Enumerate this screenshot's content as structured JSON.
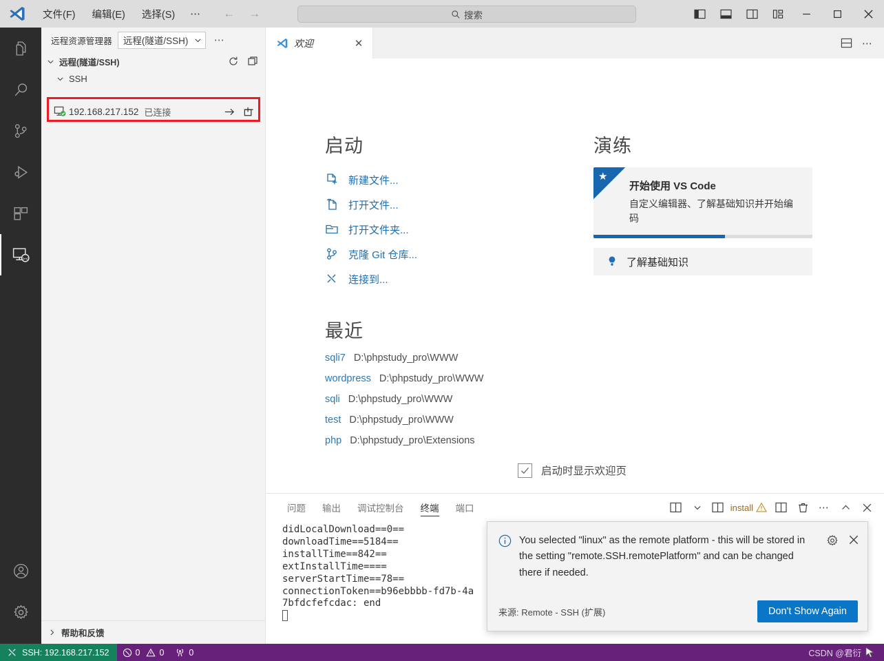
{
  "titlebar": {
    "menus": [
      "文件(F)",
      "编辑(E)",
      "选择(S)"
    ],
    "overflow": "⋯",
    "nav_back": "←",
    "nav_forward": "→",
    "search_placeholder": "搜索",
    "search_icon": "search-icon",
    "layout_buttons": [
      {
        "name": "toggle-primary-sidebar",
        "title": "切换主侧栏"
      },
      {
        "name": "toggle-panel",
        "title": "切换面板"
      },
      {
        "name": "toggle-secondary-sidebar",
        "title": "切换辅助侧栏"
      },
      {
        "name": "customize-layout",
        "title": "自定义布局"
      }
    ],
    "window_buttons": [
      "minimize",
      "maximize",
      "close"
    ]
  },
  "activitybar": {
    "items": [
      {
        "name": "explorer",
        "label": "资源管理器",
        "active": false
      },
      {
        "name": "search",
        "label": "搜索",
        "active": false
      },
      {
        "name": "source-control",
        "label": "源代码管理",
        "active": false
      },
      {
        "name": "run-debug",
        "label": "运行和调试",
        "active": false
      },
      {
        "name": "extensions",
        "label": "扩展",
        "active": false
      },
      {
        "name": "remote-explorer",
        "label": "远程资源管理器",
        "active": true
      }
    ],
    "bottom": [
      {
        "name": "accounts",
        "label": "帐户"
      },
      {
        "name": "manage",
        "label": "管理"
      }
    ]
  },
  "sidebar": {
    "title": "远程资源管理器",
    "selected_provider": "远程(隧道/SSH)",
    "more_actions": "⋯",
    "section": {
      "label": "远程(隧道/SSH)",
      "refresh_icon": "refresh-icon",
      "new_window_icon": "new-window-icon"
    },
    "group": {
      "label": "SSH"
    },
    "host": {
      "name": "192.168.217.152",
      "state": "已连接",
      "connect_icon": "arrow-right-icon",
      "new_window_icon": "open-new-window-icon"
    },
    "footer": {
      "label": "帮助和反馈"
    }
  },
  "editor": {
    "tab": {
      "label": "欢迎",
      "close": "✕",
      "icon": "vscode-logo-icon"
    },
    "tab_actions": {
      "split_icon": "split-editor-icon",
      "more_icon": "⋯"
    },
    "welcome": {
      "start_heading": "启动",
      "start_items": [
        {
          "label": "新建文件...",
          "icon": "new-file-icon"
        },
        {
          "label": "打开文件...",
          "icon": "open-file-icon"
        },
        {
          "label": "打开文件夹...",
          "icon": "open-folder-icon"
        },
        {
          "label": "克隆 Git 仓库...",
          "icon": "git-clone-icon"
        },
        {
          "label": "连接到...",
          "icon": "remote-connect-icon"
        }
      ],
      "recent_heading": "最近",
      "recent_items": [
        {
          "name": "sqli7",
          "path": "D:\\phpstudy_pro\\WWW"
        },
        {
          "name": "wordpress",
          "path": "D:\\phpstudy_pro\\WWW"
        },
        {
          "name": "sqli",
          "path": "D:\\phpstudy_pro\\WWW"
        },
        {
          "name": "test",
          "path": "D:\\phpstudy_pro\\WWW"
        },
        {
          "name": "php",
          "path": "D:\\phpstudy_pro\\Extensions"
        }
      ],
      "walkthrough_heading": "演练",
      "walkthrough_card": {
        "title": "开始使用 VS Code",
        "description": "自定义编辑器、了解基础知识并开始编码",
        "badge_icon": "star-icon",
        "progress_percent": 60
      },
      "walkthrough_item": {
        "label": "了解基础知识",
        "icon": "lightbulb-icon"
      },
      "show_on_startup_label": "启动时显示欢迎页",
      "show_on_startup_checked": true
    }
  },
  "panel": {
    "tabs": [
      {
        "label": "问题",
        "active": false
      },
      {
        "label": "输出",
        "active": false
      },
      {
        "label": "调试控制台",
        "active": false
      },
      {
        "label": "终端",
        "active": true
      },
      {
        "label": "端口",
        "active": false
      }
    ],
    "actions": {
      "split_dropdown_icon": "split-terminal-dropdown-icon",
      "chevron_down": "⌄",
      "terminal_tab_icon": "terminal-panel-icon",
      "install_label": "install",
      "warning_icon": "warning-icon",
      "split_icon": "split-terminal-icon",
      "trash_icon": "trash-icon",
      "more_icon": "⋯",
      "maximize_icon": "chevron-up-icon",
      "close_icon": "close-icon"
    },
    "terminal_lines": [
      "didLocalDownload==0==",
      "downloadTime==5184==",
      "installTime==842==",
      "extInstallTime====",
      "serverStartTime==78==",
      "connectionToken==b96ebbbb-fd7b-4a",
      "7bfdcfefcdac: end"
    ]
  },
  "toast": {
    "info_icon": "info-icon",
    "message": "You selected \"linux\" as the remote platform - this will be stored in the setting \"remote.SSH.remotePlatform\" and can be changed there if needed.",
    "gear_icon": "gear-icon",
    "close_icon": "close-icon",
    "source": "来源: Remote - SSH (扩展)",
    "button_label": "Don't Show Again"
  },
  "statusbar": {
    "remote_label": "SSH: 192.168.217.152",
    "remote_icon": "remote-icon",
    "errors": "0",
    "warnings": "0",
    "ports": "0",
    "error_icon": "error-circle-icon",
    "warning_icon": "warning-triangle-icon",
    "ports_icon": "radio-tower-icon",
    "watermark": "CSDN @君衍"
  },
  "colors": {
    "accent_blue": "#0a76c7",
    "status_purple": "#68217a",
    "remote_green": "#16825d",
    "highlight_red": "#ee1b24",
    "link_blue": "#2a7ab9"
  }
}
